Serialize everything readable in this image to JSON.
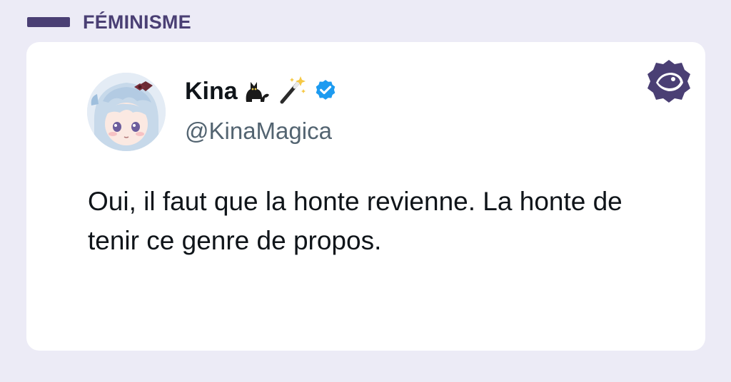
{
  "category": {
    "label": "FÉMINISME"
  },
  "colors": {
    "background": "#ecebf6",
    "brand": "#4a3f74",
    "card": "#ffffff",
    "verified": "#1d9bf0",
    "text": "#0f1419",
    "muted": "#536471"
  },
  "tweet": {
    "display_name": "Kina",
    "name_emojis": [
      "black-cat-icon",
      "magic-wand-icon"
    ],
    "verified": true,
    "handle": "@KinaMagica",
    "text": "Oui, il faut que la honte revienne. La honte de tenir ce genre de propos."
  },
  "icons": {
    "avatar": "anime-avatar",
    "brand": "eye-logo-icon"
  }
}
